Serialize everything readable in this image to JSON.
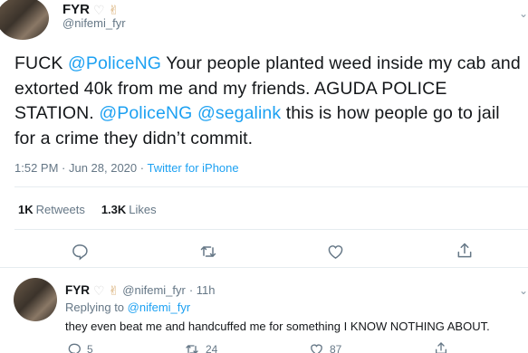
{
  "tweet": {
    "author": {
      "display_name": "FYR",
      "handle": "@nifemi_fyr"
    },
    "text_parts": [
      {
        "type": "text",
        "value": "FUCK "
      },
      {
        "type": "mention",
        "value": "@PoliceNG"
      },
      {
        "type": "text",
        "value": " Your people planted weed inside my cab and extorted 40k from me and my friends. AGUDA POLICE STATION. "
      },
      {
        "type": "mention",
        "value": "@PoliceNG"
      },
      {
        "type": "text",
        "value": " "
      },
      {
        "type": "mention",
        "value": "@segalink"
      },
      {
        "type": "text",
        "value": " this is how people go to jail for a crime they didn’t commit."
      }
    ],
    "timestamp": "1:52 PM · Jun 28, 2020 · ",
    "source": "Twitter for iPhone",
    "stats": {
      "retweets_count": "1K",
      "retweets_label": "Retweets",
      "likes_count": "1.3K",
      "likes_label": "Likes"
    },
    "icons": [
      "reply-icon",
      "retweet-icon",
      "like-icon",
      "share-icon"
    ]
  },
  "reply": {
    "author": {
      "display_name": "FYR",
      "handle": "@nifemi_fyr",
      "time": "· 11h"
    },
    "replying_to_label": "Replying to ",
    "replying_to_handle": "@nifemi_fyr",
    "text": "they even beat me and handcuffed me for something I KNOW NOTHING ABOUT.",
    "counts": {
      "replies": "5",
      "retweets": "24",
      "likes": "87"
    }
  },
  "colors": {
    "accent": "#1da1f2",
    "secondary_text": "#657786",
    "primary_text": "#14171a",
    "border": "#e6ecf0"
  }
}
